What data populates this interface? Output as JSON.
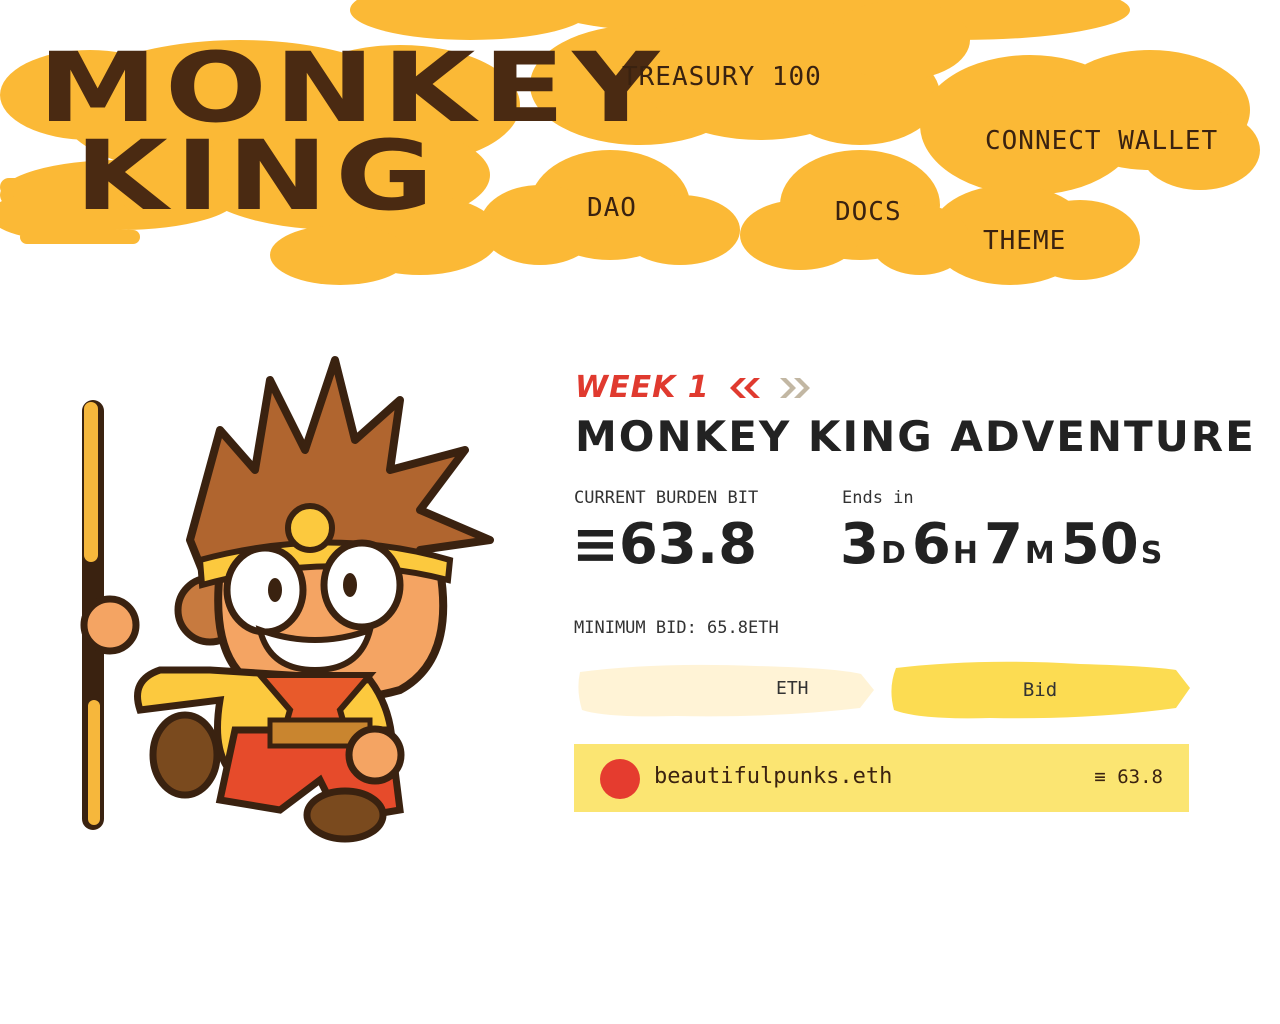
{
  "logo": {
    "line1": "MONKEY",
    "line2": "KING"
  },
  "nav": {
    "treasury": "TREASURY 100",
    "connect_wallet": "CONNECT WALLET",
    "dao": "DAO",
    "docs": "DOCS",
    "theme": "THEME"
  },
  "auction": {
    "week": "WEEK 1",
    "title": "MONKEY KING ADVENTURE",
    "current_bid_label": "CURRENT BURDEN BIT",
    "current_bid_value": "≡63.8",
    "ends_label": "Ends in",
    "countdown": {
      "days": "3",
      "d": "D",
      "hours": "6",
      "h": "H",
      "minutes": "7",
      "m": "M",
      "seconds": "50",
      "s": "S"
    },
    "minimum_bid": "MINIMUM BID: 65.8ETH",
    "input_placeholder": "",
    "input_suffix": "ETH",
    "bid_button": "Bid"
  },
  "bids": [
    {
      "bidder": "beautifulpunks.eth",
      "amount": "≡ 63.8"
    }
  ],
  "colors": {
    "cloud": "#fbb936",
    "accent_red": "#e03a2f",
    "row_bg": "#fbe572",
    "input_bg": "#fff3d6",
    "button_bg": "#fcdc52"
  }
}
